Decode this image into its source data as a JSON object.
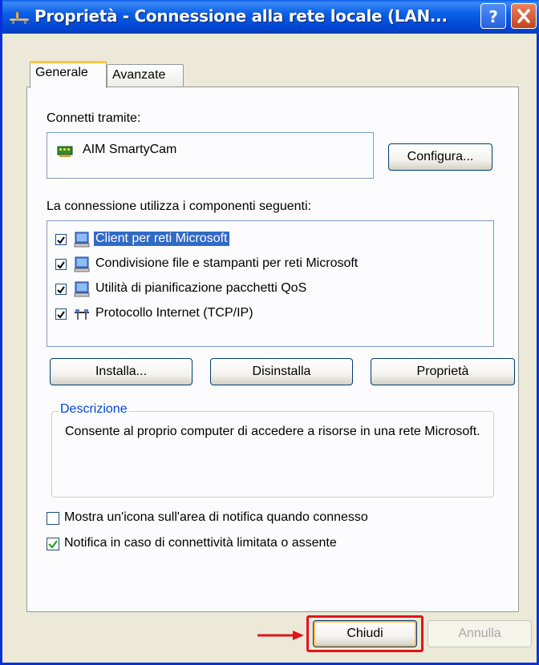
{
  "window": {
    "title": "Proprietà - Connessione alla rete locale (LAN...",
    "help_label": "?",
    "colors": {
      "titlebar": "#0a5fe6",
      "face": "#ece9d8",
      "selection": "#316ac5",
      "highlight": "#e0141b"
    }
  },
  "tabs": [
    {
      "label": "Generale",
      "active": true
    },
    {
      "label": "Avanzate",
      "active": false
    }
  ],
  "connect_via": {
    "label": "Connetti tramite:",
    "device_icon": "network-adapter-icon",
    "device_name": "AIM SmartyCam",
    "configure_button": "Configura..."
  },
  "components": {
    "label": "La connessione utilizza i componenti seguenti:",
    "items": [
      {
        "label": "Client per reti Microsoft",
        "checked": true,
        "selected": true,
        "icon": "network-client-icon"
      },
      {
        "label": "Condivisione file e stampanti per reti Microsoft",
        "checked": true,
        "selected": false,
        "icon": "network-service-icon"
      },
      {
        "label": "Utilità di pianificazione pacchetti QoS",
        "checked": true,
        "selected": false,
        "icon": "network-service-icon"
      },
      {
        "label": "Protocollo Internet (TCP/IP)",
        "checked": true,
        "selected": false,
        "icon": "network-protocol-icon"
      }
    ]
  },
  "actions": {
    "install": "Installa...",
    "uninstall": "Disinstalla",
    "properties": "Proprietà"
  },
  "description": {
    "legend": "Descrizione",
    "text": "Consente al proprio computer di accedere a risorse in una rete Microsoft."
  },
  "options": [
    {
      "label": "Mostra un'icona sull'area di notifica quando connesso",
      "checked": false
    },
    {
      "label": "Notifica in caso di connettività limitata o assente",
      "checked": true
    }
  ],
  "footer": {
    "close_button": "Chiudi",
    "cancel_button": "Annulla"
  }
}
